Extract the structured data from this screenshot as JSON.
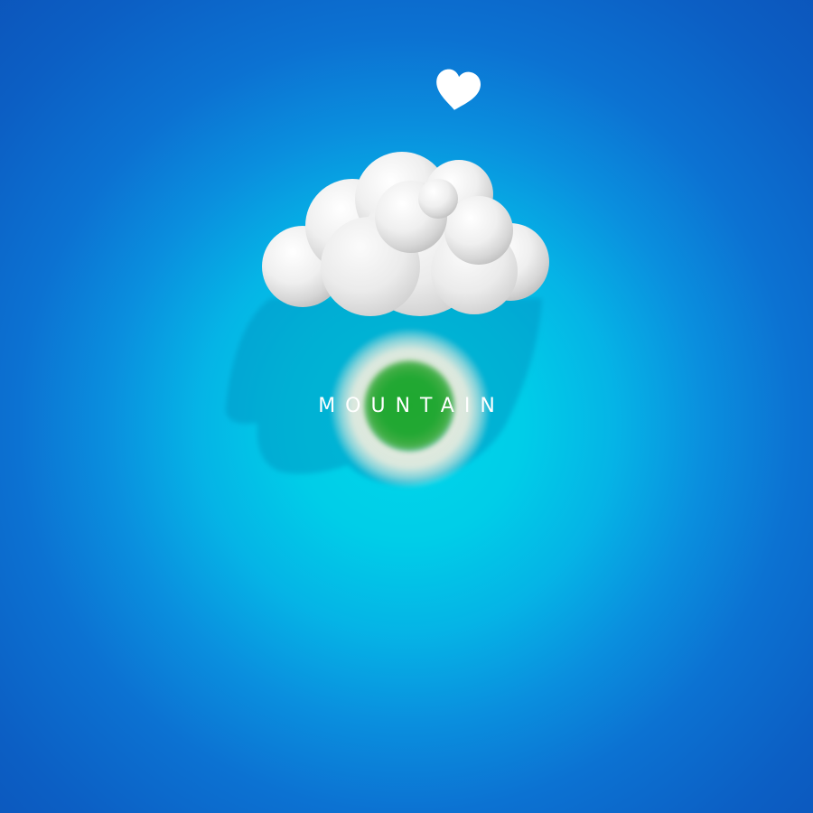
{
  "scene": {
    "title_label": "MOUNTAIN",
    "icons": {
      "heart": "heart-icon",
      "cloud": "cloud-icon",
      "orb": "green-orb-icon"
    },
    "colors": {
      "background_center": "#00d8ea",
      "background_edge": "#0b52b8",
      "cloud": "#f2f2f2",
      "orb_core": "#22a833",
      "orb_halo": "#ececde",
      "heart": "#ffffff",
      "label": "#ffffff"
    }
  }
}
